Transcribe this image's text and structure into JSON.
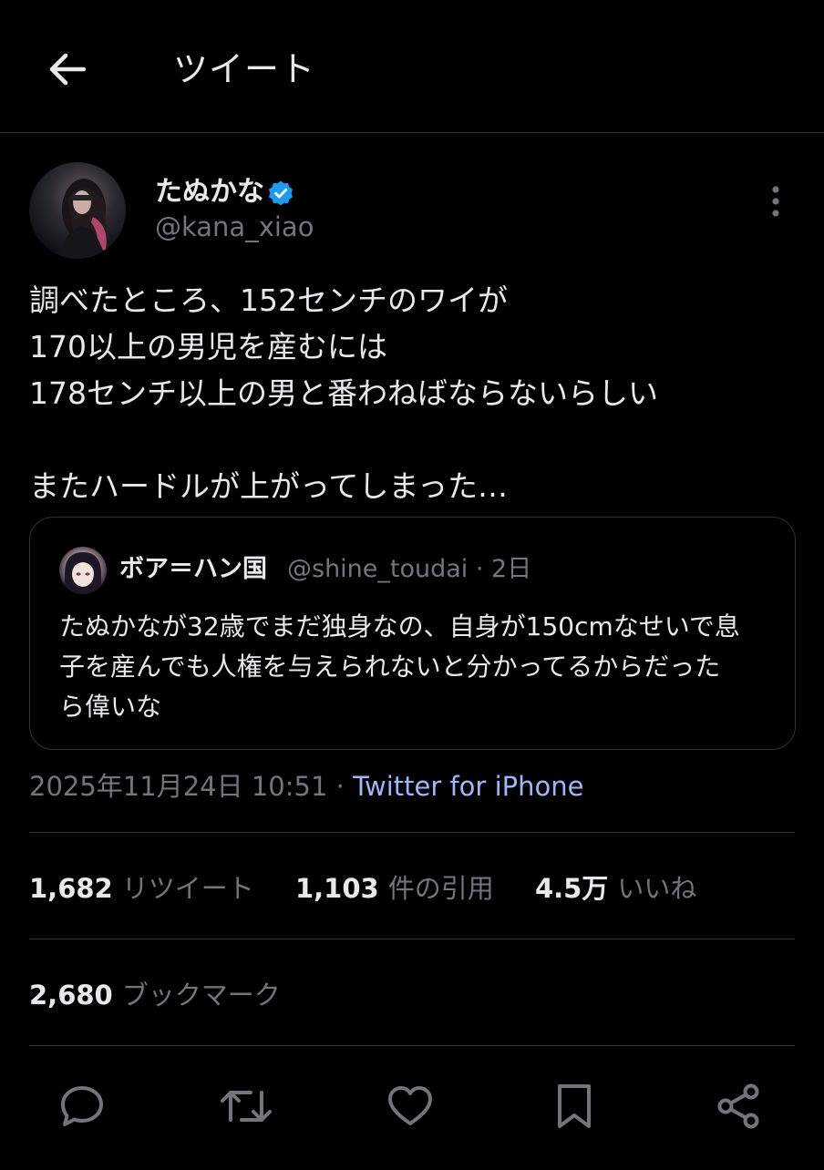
{
  "header": {
    "title": "ツイート",
    "back_icon": "arrow-left-icon"
  },
  "tweet": {
    "author": {
      "display_name": "たぬかな",
      "handle": "@kana_xiao",
      "verified": true,
      "verified_color": "#1d9bf0"
    },
    "lines": [
      "調べたところ、152センチのワイが",
      "170以上の男児を産むには",
      "178センチ以上の男と番わねばならないらしい",
      "",
      "またハードルが上がってしまった…"
    ],
    "quote": {
      "display_name": "ボア＝ハン国",
      "handle_time": "@shine_toudai · 2日",
      "lines": [
        "たぬかなが32歳でまだ独身なの、自身が150cmなせいで息",
        "子を産んでも人権を与えられないと分かってるからだった",
        "ら偉いな"
      ]
    },
    "timestamp": "2025年11月24日 10:51 · ",
    "source": "Twitter for iPhone",
    "stats": {
      "retweets": {
        "count": "1,682",
        "label": "リツイート"
      },
      "quotes": {
        "count": "1,103",
        "label": "件の引用"
      },
      "likes": {
        "count": "4.5万",
        "label": "いいね"
      },
      "bookmarks": {
        "count": "2,680",
        "label": "ブックマーク"
      }
    }
  },
  "actions": [
    "reply-icon",
    "retweet-icon",
    "like-icon",
    "bookmark-icon",
    "share-icon"
  ],
  "colors": {
    "background": "#000000",
    "text": "#e7e9ea",
    "secondary_text": "#71767b",
    "source_link": "#a3b5f9",
    "divider": "#2f3336"
  }
}
